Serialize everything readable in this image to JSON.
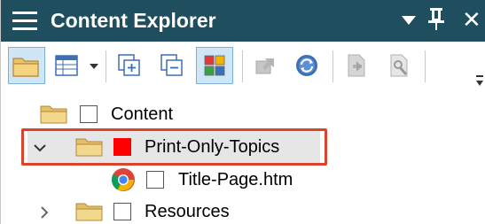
{
  "window": {
    "title": "Content Explorer",
    "title_bar_color": "#1f4e5f",
    "title_text_color": "#ffffff"
  },
  "titlebar_controls": {
    "menu_icon": "hamburger-menu-icon",
    "dropdown_icon": "chevron-down-icon",
    "pin_icon": "pin-icon",
    "close_icon": "close-icon",
    "close_glyph": "✕"
  },
  "toolbar": {
    "buttons": [
      {
        "icon": "open-folder-icon",
        "state": "active"
      },
      {
        "icon": "grid-view-icon",
        "has_dropdown": true
      },
      {
        "icon": "expand-all-icon"
      },
      {
        "icon": "collapse-all-icon"
      },
      {
        "icon": "color-tags-icon",
        "state": "active"
      },
      {
        "icon": "bind-icon",
        "state": "disabled"
      },
      {
        "icon": "sync-icon"
      },
      {
        "icon": "document-properties-icon",
        "state": "disabled"
      },
      {
        "icon": "document-edit-icon",
        "state": "disabled"
      }
    ],
    "overflow_icon": "toolbar-overflow-icon"
  },
  "tree": {
    "items": [
      {
        "label": "Content",
        "icon": "folder-icon",
        "expander": "none",
        "checked_color": "none",
        "indent": 0
      },
      {
        "label": "Print-Only-Topics",
        "icon": "folder-icon",
        "expander": "chevron-down-icon",
        "checked_color": "#ff0000",
        "selected": true,
        "indent": 1
      },
      {
        "label": "Title-Page.htm",
        "icon": "chrome-icon",
        "expander": "none",
        "checked_color": "none",
        "indent": 2
      },
      {
        "label": "Resources",
        "icon": "folder-icon",
        "expander": "chevron-right-icon",
        "checked_color": "none",
        "indent": 1
      }
    ]
  },
  "annotation": {
    "highlight_color": "#d9442b"
  }
}
